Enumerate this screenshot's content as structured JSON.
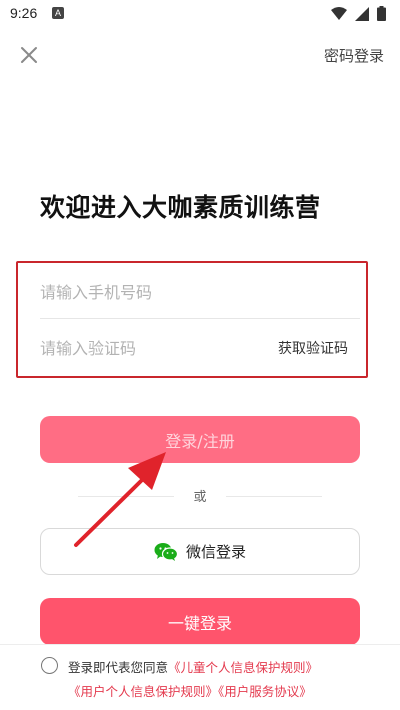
{
  "status_bar": {
    "time": "9:26",
    "notification_glyph": "A",
    "icons": [
      "wifi-icon",
      "signal-icon",
      "battery-icon"
    ]
  },
  "header": {
    "close_icon": "close-icon",
    "password_login": "密码登录"
  },
  "welcome_title": "欢迎进入大咖素质训练营",
  "form": {
    "phone_placeholder": "请输入手机号码",
    "phone_value": "",
    "code_placeholder": "请输入验证码",
    "code_value": "",
    "get_code_label": "获取验证码"
  },
  "buttons": {
    "login_register": "登录/注册",
    "or_text": "或",
    "wechat_login": "微信登录",
    "one_key_login": "一键登录"
  },
  "agreement": {
    "prefix": "登录即代表您同意",
    "child_policy": "《儿童个人信息保护规则》",
    "user_policy": "《用户个人信息保护规则》",
    "service_agreement": "《用户服务协议》"
  },
  "colors": {
    "accent": "#ff546c",
    "login_disabled": "#ff6d84",
    "highlight_box": "#c9262c",
    "arrow": "#e0232b",
    "wechat_green": "#1aad19",
    "link_red": "#e43a4e"
  }
}
